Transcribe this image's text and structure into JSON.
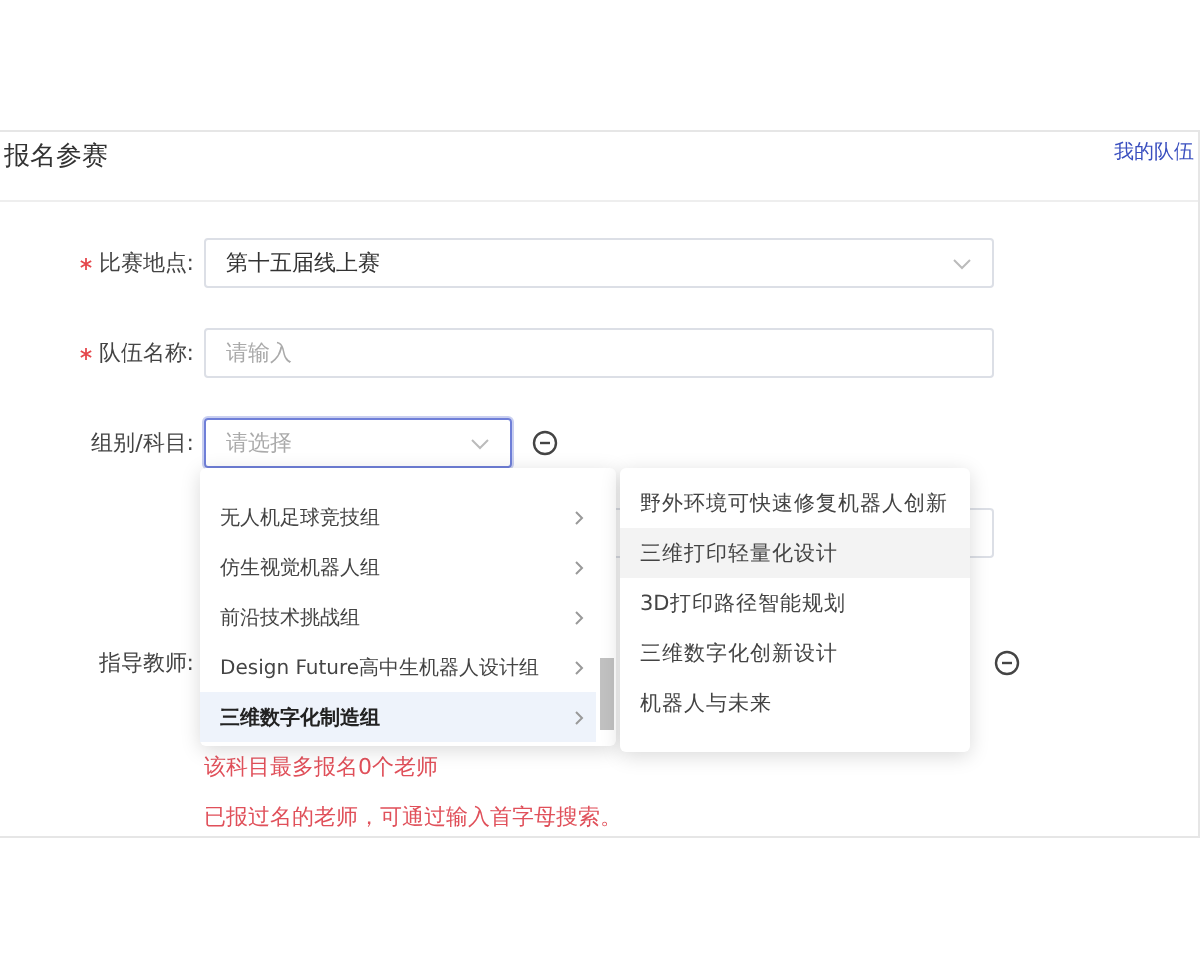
{
  "header": {
    "title": "报名参赛",
    "link": "我的队伍"
  },
  "form": {
    "fields": [
      {
        "kind": "select",
        "label": "比赛地点:",
        "required": true,
        "value": "第十五届线上赛",
        "focused": false,
        "removable": false
      },
      {
        "kind": "input",
        "label": "队伍名称:",
        "required": true,
        "placeholder": "请输入",
        "focused": false,
        "removable": false
      },
      {
        "kind": "select",
        "label": "组别/科目:",
        "required": false,
        "placeholder": "请选择",
        "focused": true,
        "removable": true
      },
      {
        "kind": "input",
        "required": false,
        "focused": false,
        "removable": false
      },
      {
        "kind": "blank",
        "label": "指导教师:",
        "required": false,
        "removable": true
      }
    ],
    "hints": [
      "该科目最多报名0个老师",
      "已报过名的老师，可通过输入首字母搜索。"
    ]
  },
  "cascader": {
    "groups": [
      {
        "label": "无人机足球竞技组",
        "selected": false
      },
      {
        "label": "仿生视觉机器人组",
        "selected": false
      },
      {
        "label": "前沿技术挑战组",
        "selected": false
      },
      {
        "label": "Design Future高中生机器人设计组",
        "selected": false
      },
      {
        "label": "三维数字化制造组",
        "selected": true
      }
    ],
    "subjects": [
      {
        "label": "野外环境可快速修复机器人创新",
        "hovered": false
      },
      {
        "label": "三维打印轻量化设计",
        "hovered": true
      },
      {
        "label": "3D打印路径智能规划",
        "hovered": false
      },
      {
        "label": "三维数字化创新设计",
        "hovered": false
      },
      {
        "label": "机器人与未来",
        "hovered": false
      }
    ]
  }
}
